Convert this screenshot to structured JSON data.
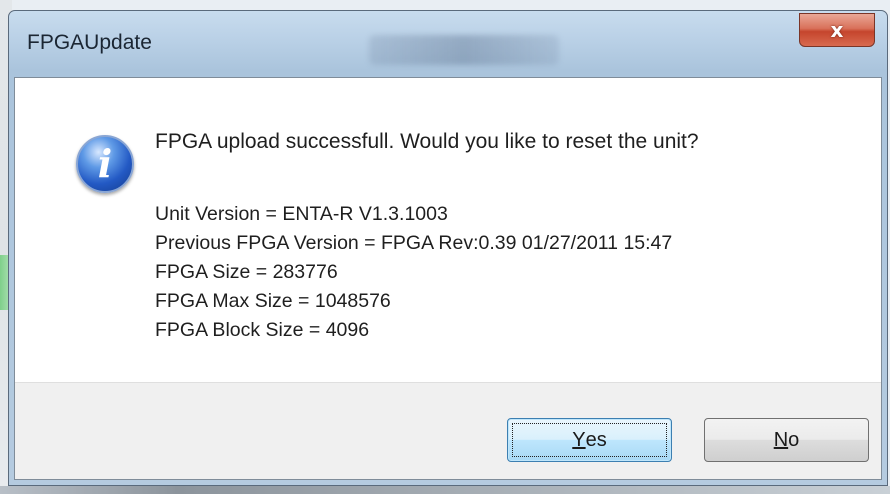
{
  "window": {
    "title": "FPGAUpdate",
    "close_glyph": "x"
  },
  "message": {
    "icon": "info-icon",
    "icon_glyph": "i",
    "text": "FPGA upload successfull. Would you like to reset the unit?",
    "details": [
      "Unit Version = ENTA-R V1.3.1003",
      "Previous FPGA Version = FPGA Rev:0.39 01/27/2011 15:47",
      "FPGA Size = 283776",
      "FPGA Max Size = 1048576",
      "FPGA Block Size = 4096"
    ]
  },
  "buttons": {
    "yes": {
      "mnemonic": "Y",
      "rest": "es"
    },
    "no": {
      "mnemonic": "N",
      "rest": "o"
    }
  },
  "colors": {
    "close_button": "#c5452d",
    "icon_blue": "#2359c4",
    "default_button_border": "#3c7fb1"
  }
}
